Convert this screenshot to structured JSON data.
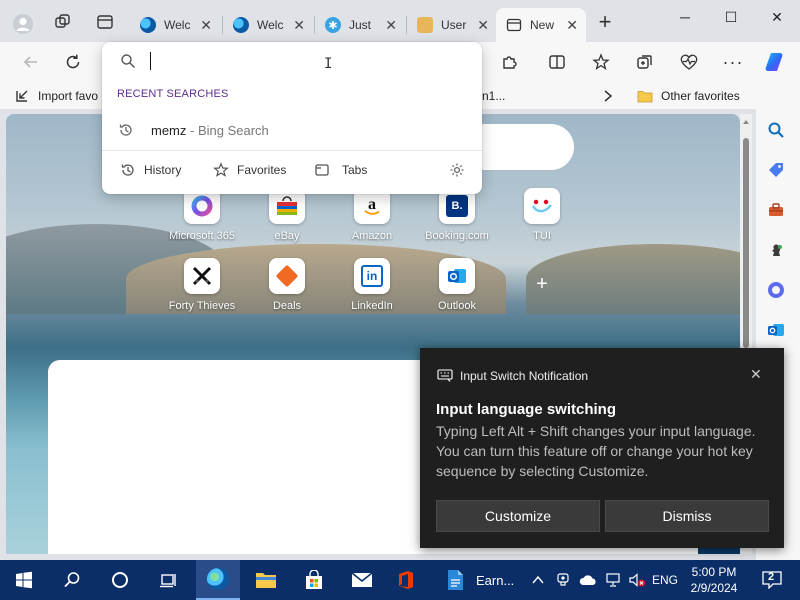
{
  "tabs": [
    {
      "title": "Welc",
      "icon": "edge-icon",
      "active": false
    },
    {
      "title": "Welc",
      "icon": "edge-icon",
      "active": false
    },
    {
      "title": "Just",
      "icon": "puzzle-app-icon",
      "active": false
    },
    {
      "title": "User",
      "icon": "user-icon",
      "active": false
    },
    {
      "title": "New",
      "icon": "new-tab-icon",
      "active": true
    }
  ],
  "window_controls": {
    "minimize": "─",
    "maximize": "☐",
    "close": "✕"
  },
  "omnibox": {
    "input_value": "",
    "recent_title": "RECENT SEARCHES",
    "recent": [
      {
        "query": "memz",
        "suffix": " - Bing Search"
      }
    ],
    "footer": [
      {
        "label": "History",
        "icon": "history-icon"
      },
      {
        "label": "Favorites",
        "icon": "star-icon"
      },
      {
        "label": "Tabs",
        "icon": "tabs-icon"
      }
    ]
  },
  "favorites_bar": {
    "left_item": "Import favo",
    "middle_item": "n1...",
    "other": "Other favorites"
  },
  "quick_links": [
    {
      "label": "Microsoft 365",
      "icon": "microsoft365-icon"
    },
    {
      "label": "eBay",
      "icon": "ebay-icon"
    },
    {
      "label": "Amazon",
      "icon": "amazon-icon"
    },
    {
      "label": "Booking.com",
      "icon": "booking-icon",
      "glyph": "B."
    },
    {
      "label": "TUI",
      "icon": "tui-icon"
    },
    {
      "label": "Forty Thieves",
      "icon": "forty-thieves-icon"
    },
    {
      "label": "Deals",
      "icon": "deals-icon"
    },
    {
      "label": "LinkedIn",
      "icon": "linkedin-icon",
      "glyph": "in"
    },
    {
      "label": "Outlook",
      "icon": "outlook-icon"
    }
  ],
  "add_shortcut": "+",
  "notification": {
    "app_title": "Input Switch Notification",
    "heading": "Input language switching",
    "body": "Typing Left Alt + Shift changes your input language. You can turn this feature off or change your hot key sequence by selecting Customize.",
    "customize": "Customize",
    "dismiss": "Dismiss"
  },
  "taskbar": {
    "app_label": "Earn...",
    "language": "ENG",
    "time": "5:00 PM",
    "date": "2/9/2024",
    "notification_count": "2"
  },
  "colors": {
    "accent": "#0067c0",
    "recent_title": "#5c2d91",
    "taskbar": "#0b2e68",
    "notification_bg": "#1f1f1f"
  }
}
